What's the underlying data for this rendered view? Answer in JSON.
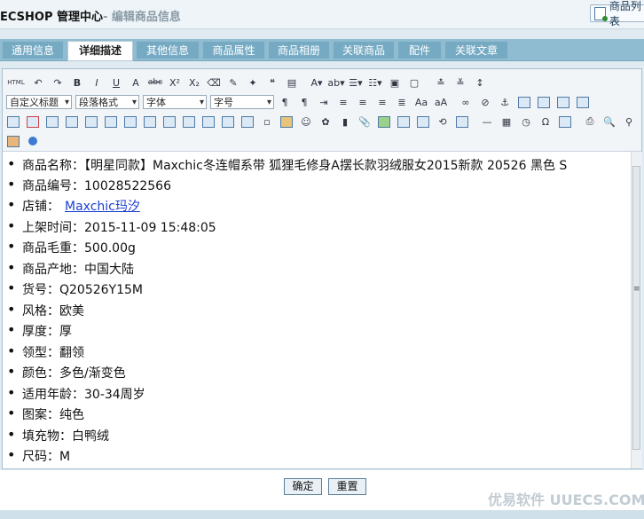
{
  "header": {
    "title": "ECSHOP 管理中心",
    "subtitle": "- 编辑商品信息",
    "list_button": "商品列表"
  },
  "tabs": [
    "通用信息",
    "详细描述",
    "其他信息",
    "商品属性",
    "商品相册",
    "关联商品",
    "配件",
    "关联文章"
  ],
  "active_tab": "详细描述",
  "toolbar": {
    "html_label": "HTML",
    "format_select": "自定义标题",
    "paragraph_select": "段落格式",
    "font_select": "字体",
    "size_select": "字号"
  },
  "content": {
    "items": [
      "商品名称：【明星同款】Maxchic冬连帽系带 狐狸毛修身A摆长款羽绒服女2015新款 20526 黑色 S",
      "商品编号：10028522566",
      "店铺：",
      "上架时间：2015-11-09 15:48:05",
      "商品毛重：500.00g",
      "商品产地：中国大陆",
      "货号：Q20526Y15M",
      "风格：欧美",
      "厚度：厚",
      "领型：翻领",
      "颜色：多色/渐变色",
      "适用年龄：30-34周岁",
      "图案：纯色",
      "填充物：白鸭绒",
      "尺码：M"
    ],
    "store_link": "Maxchic玛汐"
  },
  "buttons": {
    "confirm": "确定",
    "reset": "重置"
  },
  "watermark": "优易软件 UUECS.COM"
}
